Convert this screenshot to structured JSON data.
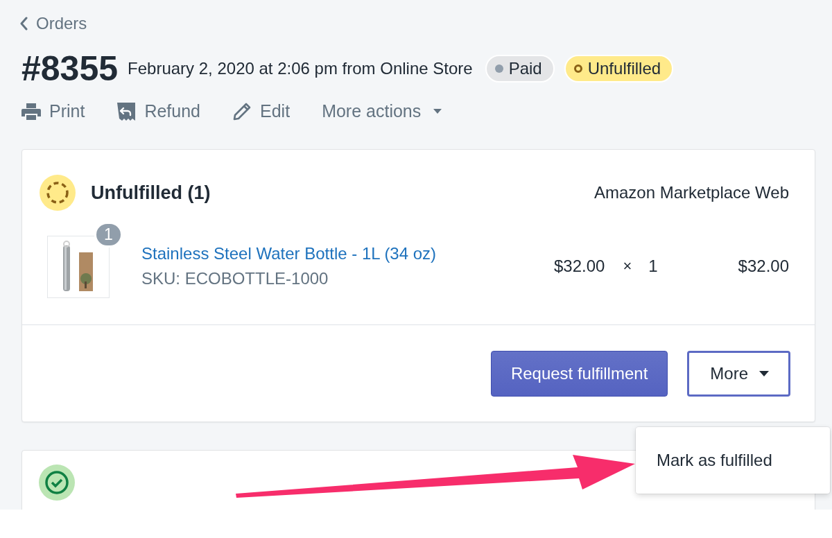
{
  "breadcrumb": {
    "label": "Orders"
  },
  "order": {
    "number": "#8355",
    "meta": "February 2, 2020 at 2:06 pm from Online Store",
    "badges": [
      {
        "label": "Paid",
        "kind": "filled",
        "color": "#e4e5e7"
      },
      {
        "label": "Unfulfilled",
        "kind": "ring",
        "color": "#ffea8a"
      }
    ]
  },
  "actions": [
    {
      "label": "Print",
      "kind": "print"
    },
    {
      "label": "Refund",
      "kind": "refund"
    },
    {
      "label": "Edit",
      "kind": "edit"
    },
    {
      "label": "More actions",
      "kind": "dropdown"
    }
  ],
  "fulfillment_card": {
    "title": "Unfulfilled (1)",
    "location": "Amazon Marketplace Web",
    "items": [
      {
        "name": "Stainless Steel Water Bottle - 1L (34 oz)",
        "sku": "SKU: ECOBOTTLE-1000",
        "quantity_badge": "1",
        "price": "$32.00",
        "times": "×",
        "quantity": "1",
        "total": "$32.00"
      }
    ],
    "primary_button": "Request fulfillment",
    "more_button": "More",
    "menu": {
      "items": [
        "Mark as fulfilled"
      ]
    }
  },
  "payment_card": {
    "kind": "paid"
  }
}
